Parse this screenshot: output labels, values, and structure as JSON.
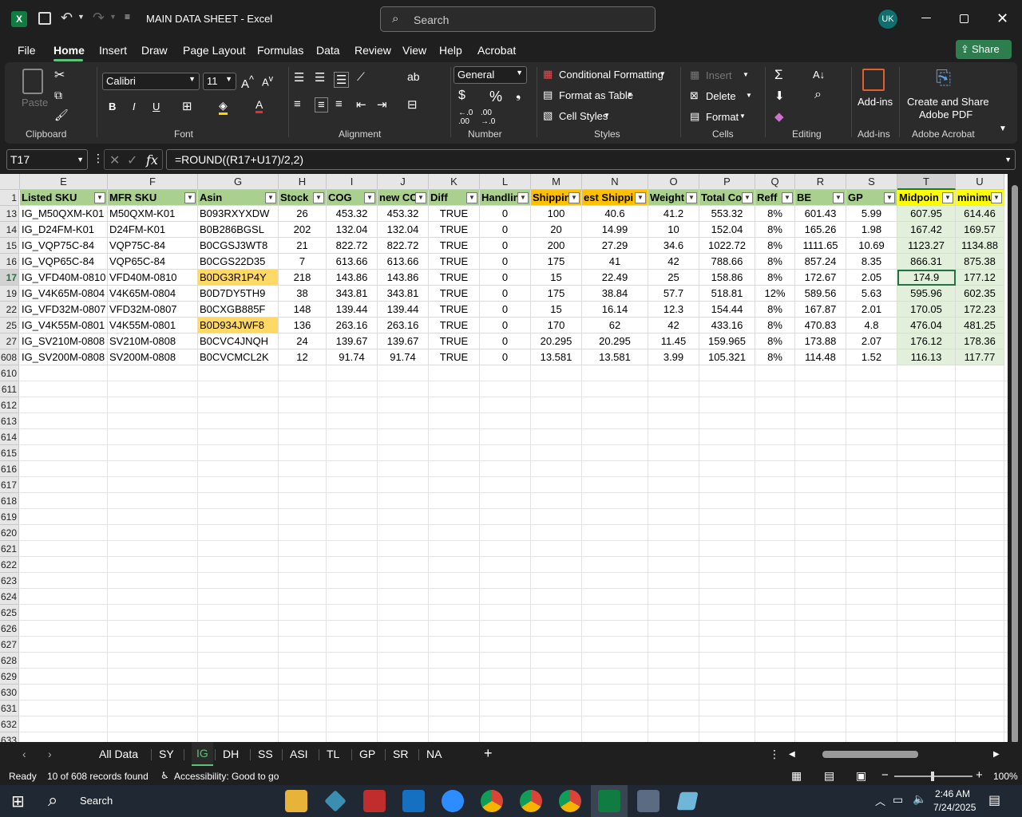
{
  "app": {
    "title": "MAIN DATA SHEET  -  Excel",
    "search_placeholder": "Search",
    "user_initials": "UK"
  },
  "menu": [
    "File",
    "Home",
    "Insert",
    "Draw",
    "Page Layout",
    "Formulas",
    "Data",
    "Review",
    "View",
    "Help",
    "Acrobat"
  ],
  "share_label": "Share",
  "ribbon": {
    "clipboard": {
      "paste": "Paste",
      "label": "Clipboard"
    },
    "font": {
      "name": "Calibri",
      "size": "11",
      "label": "Font",
      "bold": "B",
      "italic": "I",
      "underline": "U"
    },
    "alignment": {
      "label": "Alignment"
    },
    "number": {
      "format": "General",
      "label": "Number",
      "currency": "$",
      "percent": "%"
    },
    "styles": {
      "conditional": "Conditional Formatting",
      "table": "Format as Table",
      "cell": "Cell Styles",
      "label": "Styles"
    },
    "cells": {
      "insert": "Insert",
      "delete": "Delete",
      "format": "Format",
      "label": "Cells"
    },
    "editing": {
      "label": "Editing"
    },
    "addins": {
      "button": "Add-ins",
      "label": "Add-ins"
    },
    "acrobat": {
      "button1": "Create and Share",
      "button2": "Adobe PDF",
      "label": "Adobe Acrobat"
    }
  },
  "formula_bar": {
    "name_box": "T17",
    "fx": "fx",
    "formula": "=ROUND((R17+U17)/2,2)"
  },
  "columns": [
    "E",
    "F",
    "G",
    "H",
    "I",
    "J",
    "K",
    "L",
    "M",
    "N",
    "O",
    "P",
    "Q",
    "R",
    "S",
    "T",
    "U"
  ],
  "headers": [
    "Listed SKU",
    "MFR SKU",
    "Asin",
    "Stock",
    "COG",
    "new CC",
    "Diff",
    "Handlin",
    "Shippin",
    "est Shippi",
    "Weight",
    "Total Co",
    "Reff",
    "BE",
    "GP",
    "Midpoin",
    "minimu"
  ],
  "rows": [
    {
      "n": "13",
      "v": [
        "IG_M50QXM-K01",
        "M50QXM-K01",
        "B093RXYXDW",
        "26",
        "453.32",
        "453.32",
        "TRUE",
        "0",
        "100",
        "40.6",
        "41.2",
        "553.32",
        "8%",
        "601.43",
        "5.99",
        "607.95",
        "614.46"
      ]
    },
    {
      "n": "14",
      "v": [
        "IG_D24FM-K01",
        "D24FM-K01",
        "B0B286BGSL",
        "202",
        "132.04",
        "132.04",
        "TRUE",
        "0",
        "20",
        "14.99",
        "10",
        "152.04",
        "8%",
        "165.26",
        "1.98",
        "167.42",
        "169.57"
      ]
    },
    {
      "n": "15",
      "v": [
        "IG_VQP75C-84",
        "VQP75C-84",
        "B0CGSJ3WT8",
        "21",
        "822.72",
        "822.72",
        "TRUE",
        "0",
        "200",
        "27.29",
        "34.6",
        "1022.72",
        "8%",
        "1111.65",
        "10.69",
        "1123.27",
        "1134.88"
      ]
    },
    {
      "n": "16",
      "v": [
        "IG_VQP65C-84",
        "VQP65C-84",
        "B0CGS22D35",
        "7",
        "613.66",
        "613.66",
        "TRUE",
        "0",
        "175",
        "41",
        "42",
        "788.66",
        "8%",
        "857.24",
        "8.35",
        "866.31",
        "875.38"
      ]
    },
    {
      "n": "17",
      "v": [
        "IG_VFD40M-0810",
        "VFD40M-0810",
        "B0DG3R1P4Y",
        "218",
        "143.86",
        "143.86",
        "TRUE",
        "0",
        "15",
        "22.49",
        "25",
        "158.86",
        "8%",
        "172.67",
        "2.05",
        "174.9",
        "177.12"
      ]
    },
    {
      "n": "19",
      "v": [
        "IG_V4K65M-0804",
        "V4K65M-0804",
        "B0D7DY5TH9",
        "38",
        "343.81",
        "343.81",
        "TRUE",
        "0",
        "175",
        "38.84",
        "57.7",
        "518.81",
        "12%",
        "589.56",
        "5.63",
        "595.96",
        "602.35"
      ]
    },
    {
      "n": "22",
      "v": [
        "IG_VFD32M-0807",
        "VFD32M-0807",
        "B0CXGB885F",
        "148",
        "139.44",
        "139.44",
        "TRUE",
        "0",
        "15",
        "16.14",
        "12.3",
        "154.44",
        "8%",
        "167.87",
        "2.01",
        "170.05",
        "172.23"
      ]
    },
    {
      "n": "25",
      "v": [
        "IG_V4K55M-0801",
        "V4K55M-0801",
        "B0D934JWF8",
        "136",
        "263.16",
        "263.16",
        "TRUE",
        "0",
        "170",
        "62",
        "42",
        "433.16",
        "8%",
        "470.83",
        "4.8",
        "476.04",
        "481.25"
      ]
    },
    {
      "n": "27",
      "v": [
        "IG_SV210M-0808",
        "SV210M-0808",
        "B0CVC4JNQH",
        "24",
        "139.67",
        "139.67",
        "TRUE",
        "0",
        "20.295",
        "20.295",
        "11.45",
        "159.965",
        "8%",
        "173.88",
        "2.07",
        "176.12",
        "178.36"
      ]
    },
    {
      "n": "608",
      "v": [
        "IG_SV200M-0808",
        "SV200M-0808",
        "B0CVCMCL2K",
        "12",
        "91.74",
        "91.74",
        "TRUE",
        "0",
        "13.581",
        "13.581",
        "3.99",
        "105.321",
        "8%",
        "114.48",
        "1.52",
        "116.13",
        "117.77"
      ]
    }
  ],
  "empty_rows": [
    "610",
    "611",
    "612",
    "613",
    "614",
    "615",
    "616",
    "617",
    "618",
    "619",
    "620",
    "621",
    "622",
    "623",
    "624",
    "625",
    "626",
    "627",
    "628",
    "629",
    "630",
    "631",
    "632",
    "633"
  ],
  "sheets": [
    "All Data",
    "SY",
    "IG",
    "DH",
    "SS",
    "ASI",
    "TL",
    "GP",
    "SR",
    "NA"
  ],
  "active_sheet": "IG",
  "status": {
    "ready": "Ready",
    "records": "10 of 608 records found",
    "accessibility": "Accessibility: Good to go",
    "zoom": "100%"
  },
  "taskbar": {
    "search": "Search",
    "time": "2:46 AM",
    "date": "7/24/2025"
  }
}
